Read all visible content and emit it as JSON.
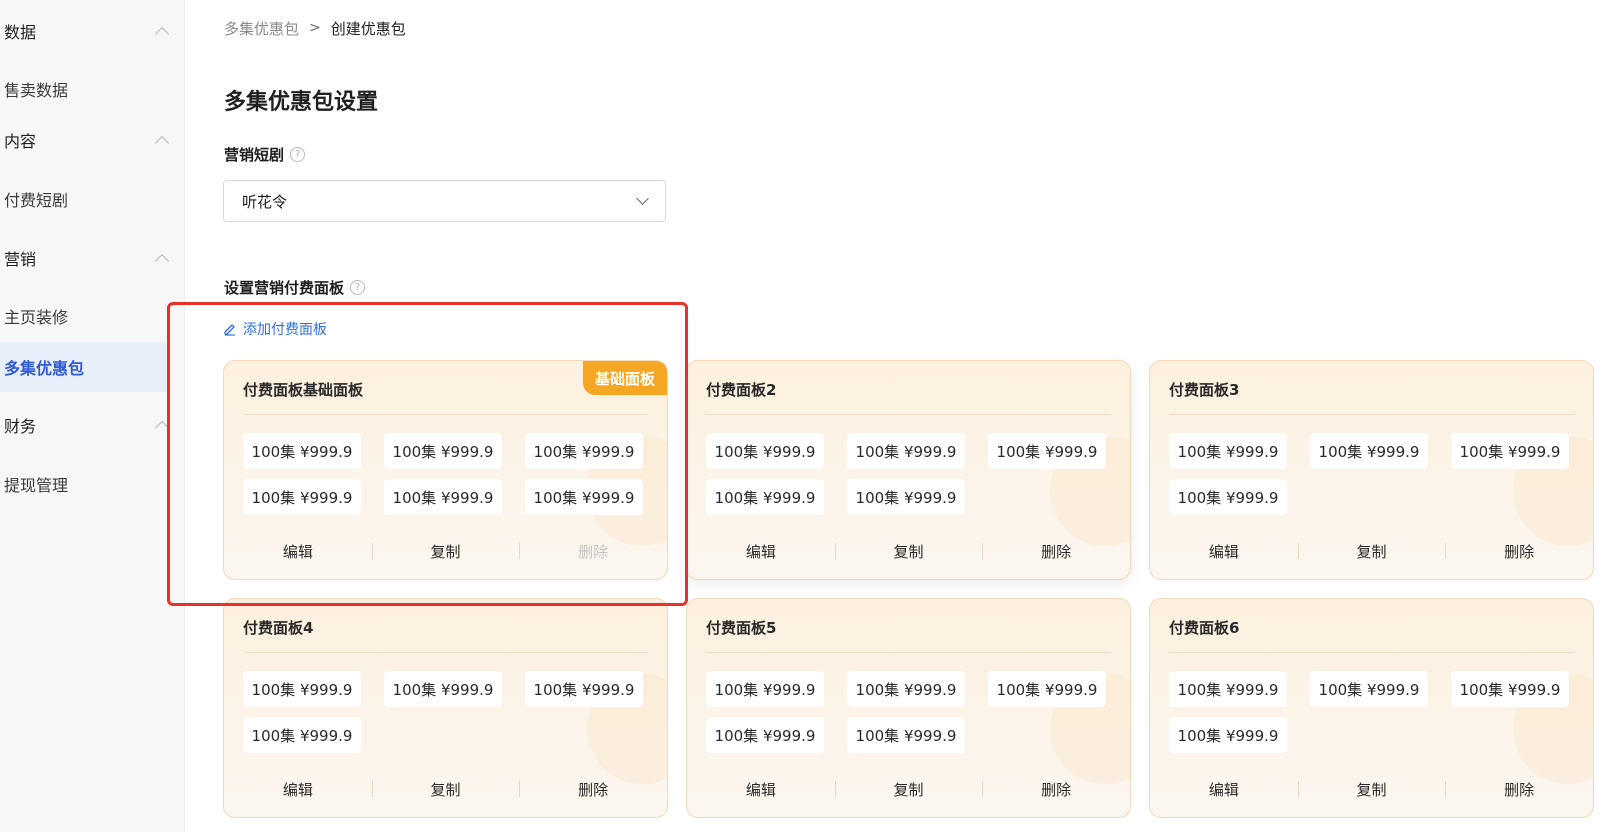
{
  "sidebar": {
    "groups": [
      {
        "label": "数据",
        "items": [
          {
            "label": "售卖数据"
          }
        ]
      },
      {
        "label": "内容",
        "items": [
          {
            "label": "付费短剧"
          }
        ]
      },
      {
        "label": "营销",
        "items": [
          {
            "label": "主页装修"
          },
          {
            "label": "多集优惠包"
          }
        ]
      },
      {
        "label": "财务",
        "items": [
          {
            "label": "提现管理"
          }
        ]
      }
    ],
    "active_item": "多集优惠包"
  },
  "breadcrumb": {
    "parent": "多集优惠包",
    "separator": ">",
    "current": "创建优惠包"
  },
  "page_title": "多集优惠包设置",
  "drama_field": {
    "label": "营销短剧",
    "help_icon": "?",
    "selected_value": "听花令"
  },
  "panel_section": {
    "label": "设置营销付费面板",
    "help_icon": "?",
    "add_link": "添加付费面板"
  },
  "cards": [
    {
      "title": "付费面板基础面板",
      "badge": "基础面板",
      "chips": [
        "100集 ¥999.9",
        "100集 ¥999.9",
        "100集 ¥999.9",
        "100集 ¥999.9",
        "100集 ¥999.9",
        "100集 ¥999.9"
      ],
      "actions": {
        "edit": "编辑",
        "copy": "复制",
        "delete": "删除"
      },
      "delete_disabled": true
    },
    {
      "title": "付费面板2",
      "chips": [
        "100集 ¥999.9",
        "100集 ¥999.9",
        "100集 ¥999.9",
        "100集 ¥999.9",
        "100集 ¥999.9"
      ],
      "actions": {
        "edit": "编辑",
        "copy": "复制",
        "delete": "删除"
      }
    },
    {
      "title": "付费面板3",
      "chips": [
        "100集 ¥999.9",
        "100集 ¥999.9",
        "100集 ¥999.9",
        "100集 ¥999.9"
      ],
      "actions": {
        "edit": "编辑",
        "copy": "复制",
        "delete": "删除"
      }
    },
    {
      "title": "付费面板4",
      "chips": [
        "100集 ¥999.9",
        "100集 ¥999.9",
        "100集 ¥999.9",
        "100集 ¥999.9"
      ],
      "actions": {
        "edit": "编辑",
        "copy": "复制",
        "delete": "删除"
      }
    },
    {
      "title": "付费面板5",
      "chips": [
        "100集 ¥999.9",
        "100集 ¥999.9",
        "100集 ¥999.9",
        "100集 ¥999.9",
        "100集 ¥999.9"
      ],
      "actions": {
        "edit": "编辑",
        "copy": "复制",
        "delete": "删除"
      }
    },
    {
      "title": "付费面板6",
      "chips": [
        "100集 ¥999.9",
        "100集 ¥999.9",
        "100集 ¥999.9",
        "100集 ¥999.9"
      ],
      "actions": {
        "edit": "编辑",
        "copy": "复制",
        "delete": "删除"
      }
    }
  ],
  "colors": {
    "accent": "#2f6fe6",
    "badge": "#f5a623",
    "highlight": "#e8312a",
    "active_nav_bg": "#e9eefb"
  }
}
